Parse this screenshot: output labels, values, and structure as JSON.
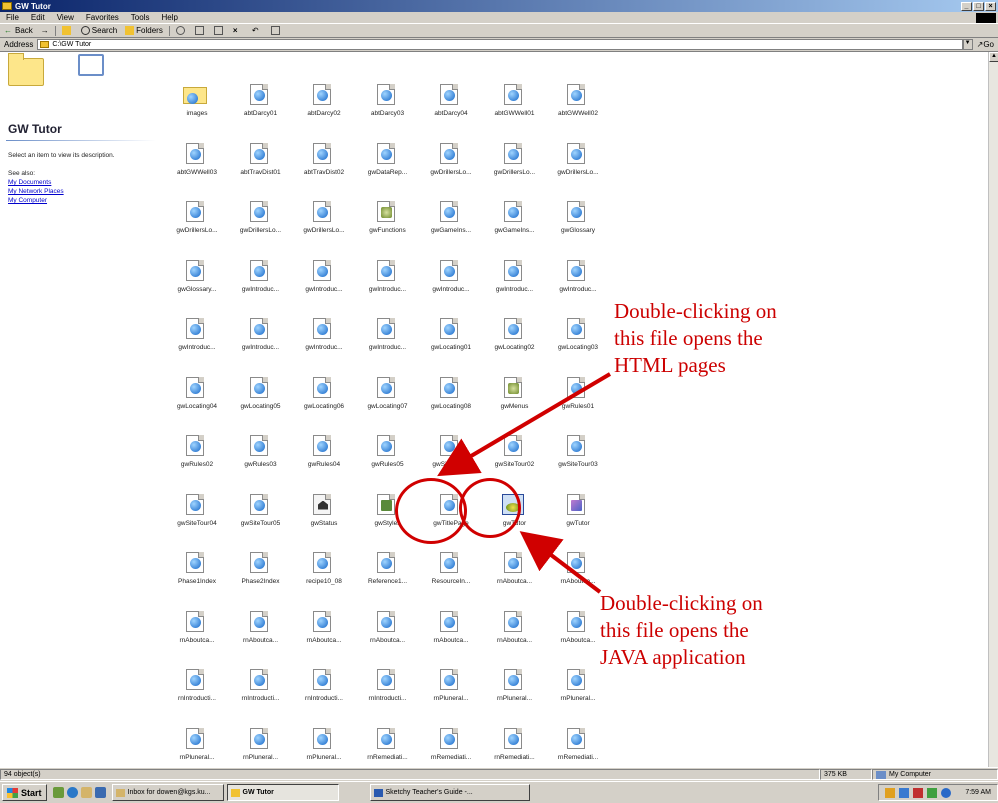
{
  "window": {
    "title": "GW Tutor",
    "buttons": [
      "_",
      "□",
      "×"
    ]
  },
  "menu": [
    "File",
    "Edit",
    "View",
    "Favorites",
    "Tools",
    "Help"
  ],
  "toolbar": {
    "back": "Back",
    "forward": "→",
    "search": "Search",
    "folders": "Folders"
  },
  "address": {
    "label": "Address",
    "path": "C:\\GW Tutor",
    "go": "Go"
  },
  "left_pane": {
    "title": "GW Tutor",
    "description": "Select an item to view its description.",
    "see_also": "See also:",
    "links": [
      "My Documents",
      "My Network Places",
      "My Computer"
    ]
  },
  "files": [
    {
      "name": "images",
      "icon": "folder-icon"
    },
    {
      "name": "abtDarcy01",
      "icon": "html-file-icon"
    },
    {
      "name": "abtDarcy02",
      "icon": "html-file-icon"
    },
    {
      "name": "abtDarcy03",
      "icon": "html-file-icon"
    },
    {
      "name": "abtDarcy04",
      "icon": "html-file-icon"
    },
    {
      "name": "abtGWWell01",
      "icon": "html-file-icon"
    },
    {
      "name": "abtGWWell02",
      "icon": "html-file-icon"
    },
    {
      "name": "abtGWWell03",
      "icon": "html-file-icon"
    },
    {
      "name": "abtTravDist01",
      "icon": "html-file-icon"
    },
    {
      "name": "abtTravDist02",
      "icon": "html-file-icon"
    },
    {
      "name": "gwDataRep...",
      "icon": "html-file-icon"
    },
    {
      "name": "gwDrillersLo...",
      "icon": "html-file-icon"
    },
    {
      "name": "gwDrillersLo...",
      "icon": "html-file-icon"
    },
    {
      "name": "gwDrillersLo...",
      "icon": "html-file-icon"
    },
    {
      "name": "gwDrillersLo...",
      "icon": "html-file-icon"
    },
    {
      "name": "gwDrillersLo...",
      "icon": "html-file-icon"
    },
    {
      "name": "gwDrillersLo...",
      "icon": "html-file-icon"
    },
    {
      "name": "gwFunctions",
      "icon": "script-file-icon"
    },
    {
      "name": "gwGameIns...",
      "icon": "html-file-icon"
    },
    {
      "name": "gwGameIns...",
      "icon": "html-file-icon"
    },
    {
      "name": "gwGlossary",
      "icon": "html-file-icon"
    },
    {
      "name": "gwGlossary...",
      "icon": "html-file-icon"
    },
    {
      "name": "gwIntroduc...",
      "icon": "html-file-icon"
    },
    {
      "name": "gwIntroduc...",
      "icon": "html-file-icon"
    },
    {
      "name": "gwIntroduc...",
      "icon": "html-file-icon"
    },
    {
      "name": "gwIntroduc...",
      "icon": "html-file-icon"
    },
    {
      "name": "gwIntroduc...",
      "icon": "html-file-icon"
    },
    {
      "name": "gwIntroduc...",
      "icon": "html-file-icon"
    },
    {
      "name": "gwIntroduc...",
      "icon": "html-file-icon"
    },
    {
      "name": "gwIntroduc...",
      "icon": "html-file-icon"
    },
    {
      "name": "gwIntroduc...",
      "icon": "html-file-icon"
    },
    {
      "name": "gwIntroduc...",
      "icon": "html-file-icon"
    },
    {
      "name": "gwLocating01",
      "icon": "html-file-icon"
    },
    {
      "name": "gwLocating02",
      "icon": "html-file-icon"
    },
    {
      "name": "gwLocating03",
      "icon": "html-file-icon"
    },
    {
      "name": "gwLocating04",
      "icon": "html-file-icon"
    },
    {
      "name": "gwLocating05",
      "icon": "html-file-icon"
    },
    {
      "name": "gwLocating06",
      "icon": "html-file-icon"
    },
    {
      "name": "gwLocating07",
      "icon": "html-file-icon"
    },
    {
      "name": "gwLocating08",
      "icon": "html-file-icon"
    },
    {
      "name": "gwMenus",
      "icon": "script-file-icon"
    },
    {
      "name": "gwRules01",
      "icon": "html-file-icon"
    },
    {
      "name": "gwRules02",
      "icon": "html-file-icon"
    },
    {
      "name": "gwRules03",
      "icon": "html-file-icon"
    },
    {
      "name": "gwRules04",
      "icon": "html-file-icon"
    },
    {
      "name": "gwRules05",
      "icon": "html-file-icon"
    },
    {
      "name": "gwSiteTour...",
      "icon": "html-file-icon"
    },
    {
      "name": "gwSiteTour02",
      "icon": "html-file-icon"
    },
    {
      "name": "gwSiteTour03",
      "icon": "html-file-icon"
    },
    {
      "name": "gwSiteTour04",
      "icon": "html-file-icon"
    },
    {
      "name": "gwSiteTour05",
      "icon": "html-file-icon"
    },
    {
      "name": "gwStatus",
      "icon": "house-file-icon"
    },
    {
      "name": "gwStyles",
      "icon": "stylesheet-file-icon"
    },
    {
      "name": "gwTitlePage",
      "icon": "html-file-icon"
    },
    {
      "name": "gwTutor",
      "icon": "java-app-icon"
    },
    {
      "name": "gwTutor",
      "icon": "jar-file-icon"
    },
    {
      "name": "Phase1Index",
      "icon": "html-file-icon"
    },
    {
      "name": "Phase2Index",
      "icon": "html-file-icon"
    },
    {
      "name": "recipe10_08",
      "icon": "html-file-icon"
    },
    {
      "name": "Reference1...",
      "icon": "html-file-icon"
    },
    {
      "name": "ResourceIn...",
      "icon": "html-file-icon"
    },
    {
      "name": "rnAboutca...",
      "icon": "html-file-icon"
    },
    {
      "name": "rnAboutca...",
      "icon": "html-file-icon"
    },
    {
      "name": "rnAboutca...",
      "icon": "html-file-icon"
    },
    {
      "name": "rnAboutca...",
      "icon": "html-file-icon"
    },
    {
      "name": "rnAboutca...",
      "icon": "html-file-icon"
    },
    {
      "name": "rnAboutca...",
      "icon": "html-file-icon"
    },
    {
      "name": "rnAboutca...",
      "icon": "html-file-icon"
    },
    {
      "name": "rnAboutca...",
      "icon": "html-file-icon"
    },
    {
      "name": "rnAboutca...",
      "icon": "html-file-icon"
    },
    {
      "name": "rnIntroducti...",
      "icon": "html-file-icon"
    },
    {
      "name": "rnIntroducti...",
      "icon": "html-file-icon"
    },
    {
      "name": "rnIntroducti...",
      "icon": "html-file-icon"
    },
    {
      "name": "rnIntroducti...",
      "icon": "html-file-icon"
    },
    {
      "name": "rnPluneral...",
      "icon": "html-file-icon"
    },
    {
      "name": "rnPluneral...",
      "icon": "html-file-icon"
    },
    {
      "name": "rnPluneral...",
      "icon": "html-file-icon"
    },
    {
      "name": "rnPluneral...",
      "icon": "html-file-icon"
    },
    {
      "name": "rnPluneral...",
      "icon": "html-file-icon"
    },
    {
      "name": "rnPluneral...",
      "icon": "html-file-icon"
    },
    {
      "name": "rnRemediati...",
      "icon": "html-file-icon"
    },
    {
      "name": "rnRemediati...",
      "icon": "html-file-icon"
    },
    {
      "name": "rnRemediati...",
      "icon": "html-file-icon"
    },
    {
      "name": "rnRemediati...",
      "icon": "html-file-icon"
    }
  ],
  "annotations": {
    "html": [
      "Double-clicking on",
      "this file opens the",
      "HTML pages"
    ],
    "java": [
      "Double-clicking on",
      "this file opens the",
      "JAVA application"
    ],
    "color": "#cc0000"
  },
  "status": {
    "objects": "94 object(s)",
    "size": "375 KB",
    "zone": "My Computer"
  },
  "taskbar": {
    "start": "Start",
    "tasks": [
      "Inbox for dowen@kgs.ku...",
      "GW Tutor",
      "Sketchy Teacher's Guide -..."
    ],
    "clock": "7:59 AM"
  }
}
